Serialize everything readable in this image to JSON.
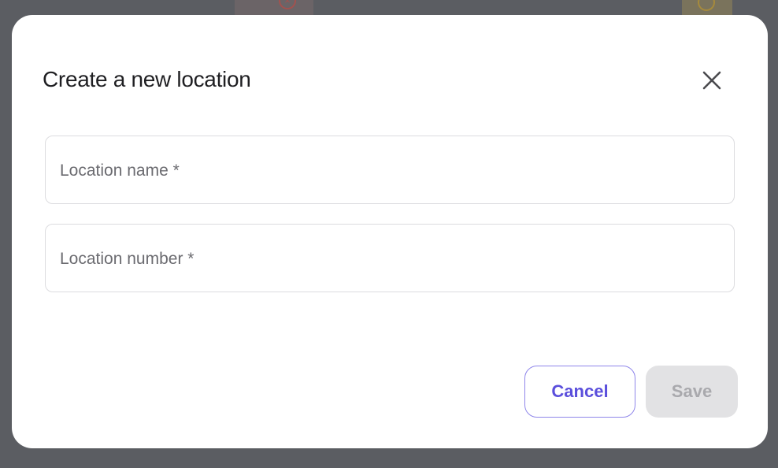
{
  "modal": {
    "title": "Create a new location",
    "close_icon": "close-icon",
    "fields": [
      {
        "label": "Location name *",
        "value": ""
      },
      {
        "label": "Location number *",
        "value": ""
      }
    ],
    "actions": {
      "cancel_label": "Cancel",
      "save_label": "Save"
    }
  },
  "colors": {
    "overlay": "#5d5f63",
    "modal_bg": "#ffffff",
    "accent": "#5b4fdc",
    "cancel_border": "#8f86ea",
    "save_disabled_bg": "#e2e2e4",
    "save_disabled_text": "#a9a9ad",
    "field_border": "#dcdcdf",
    "error_icon": "#a2524f",
    "pending_icon": "#a68a3c"
  }
}
